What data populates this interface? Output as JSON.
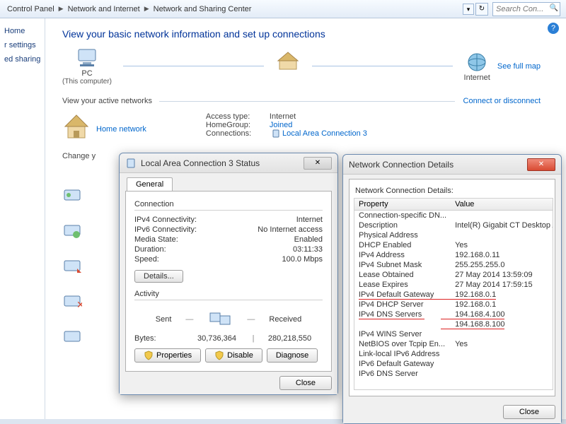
{
  "addressbar": {
    "crumbs": [
      "Control Panel",
      "Network and Internet",
      "Network and Sharing Center"
    ],
    "search_placeholder": "Search Con..."
  },
  "sidebar": {
    "items": [
      "Home",
      "r settings",
      "ed sharing"
    ]
  },
  "main": {
    "heading": "View your basic network information and set up connections",
    "see_map": "See full map",
    "map_pc": "PC",
    "map_pc_sub": "(This computer)",
    "map_internet": "Internet",
    "active_title": "View your active networks",
    "connect_link": "Connect or disconnect",
    "home_network": "Home network",
    "access_k": "Access type:",
    "access_v": "Internet",
    "homegroup_k": "HomeGroup:",
    "homegroup_v": "Joined",
    "conn_k": "Connections:",
    "conn_v": "Local Area Connection 3",
    "change_title": "Change y"
  },
  "status_dialog": {
    "title": "Local Area Connection 3 Status",
    "tab": "General",
    "connection_title": "Connection",
    "rows": [
      {
        "k": "IPv4 Connectivity:",
        "v": "Internet"
      },
      {
        "k": "IPv6 Connectivity:",
        "v": "No Internet access"
      },
      {
        "k": "Media State:",
        "v": "Enabled"
      },
      {
        "k": "Duration:",
        "v": "03:11:33"
      },
      {
        "k": "Speed:",
        "v": "100.0 Mbps"
      }
    ],
    "details_btn": "Details...",
    "activity_title": "Activity",
    "sent": "Sent",
    "received": "Received",
    "bytes_label": "Bytes:",
    "bytes_sent": "30,736,364",
    "bytes_recv": "280,218,550",
    "properties_btn": "Properties",
    "disable_btn": "Disable",
    "diagnose_btn": "Diagnose",
    "close_btn": "Close"
  },
  "details_dialog": {
    "title": "Network Connection Details",
    "label": "Network Connection Details:",
    "col_property": "Property",
    "col_value": "Value",
    "rows": [
      {
        "p": "Connection-specific DN...",
        "v": ""
      },
      {
        "p": "Description",
        "v": "Intel(R) Gigabit CT Desktop Adapter"
      },
      {
        "p": "Physical Address",
        "v": ""
      },
      {
        "p": "DHCP Enabled",
        "v": "Yes"
      },
      {
        "p": "IPv4 Address",
        "v": "192.168.0.11"
      },
      {
        "p": "IPv4 Subnet Mask",
        "v": "255.255.255.0"
      },
      {
        "p": "Lease Obtained",
        "v": "27 May 2014 13:59:09"
      },
      {
        "p": "Lease Expires",
        "v": "27 May 2014 17:59:15"
      },
      {
        "p": "IPv4 Default Gateway",
        "v": "192.168.0.1",
        "hl": true
      },
      {
        "p": "IPv4 DHCP Server",
        "v": "192.168.0.1"
      },
      {
        "p": "IPv4 DNS Servers",
        "v": "194.168.4.100",
        "hl": true
      },
      {
        "p": "",
        "v": "194.168.8.100",
        "hl2": true
      },
      {
        "p": "IPv4 WINS Server",
        "v": ""
      },
      {
        "p": "NetBIOS over Tcpip En...",
        "v": "Yes"
      },
      {
        "p": "Link-local IPv6 Address",
        "v": ""
      },
      {
        "p": "IPv6 Default Gateway",
        "v": ""
      },
      {
        "p": "IPv6 DNS Server",
        "v": ""
      }
    ],
    "close_btn": "Close"
  }
}
